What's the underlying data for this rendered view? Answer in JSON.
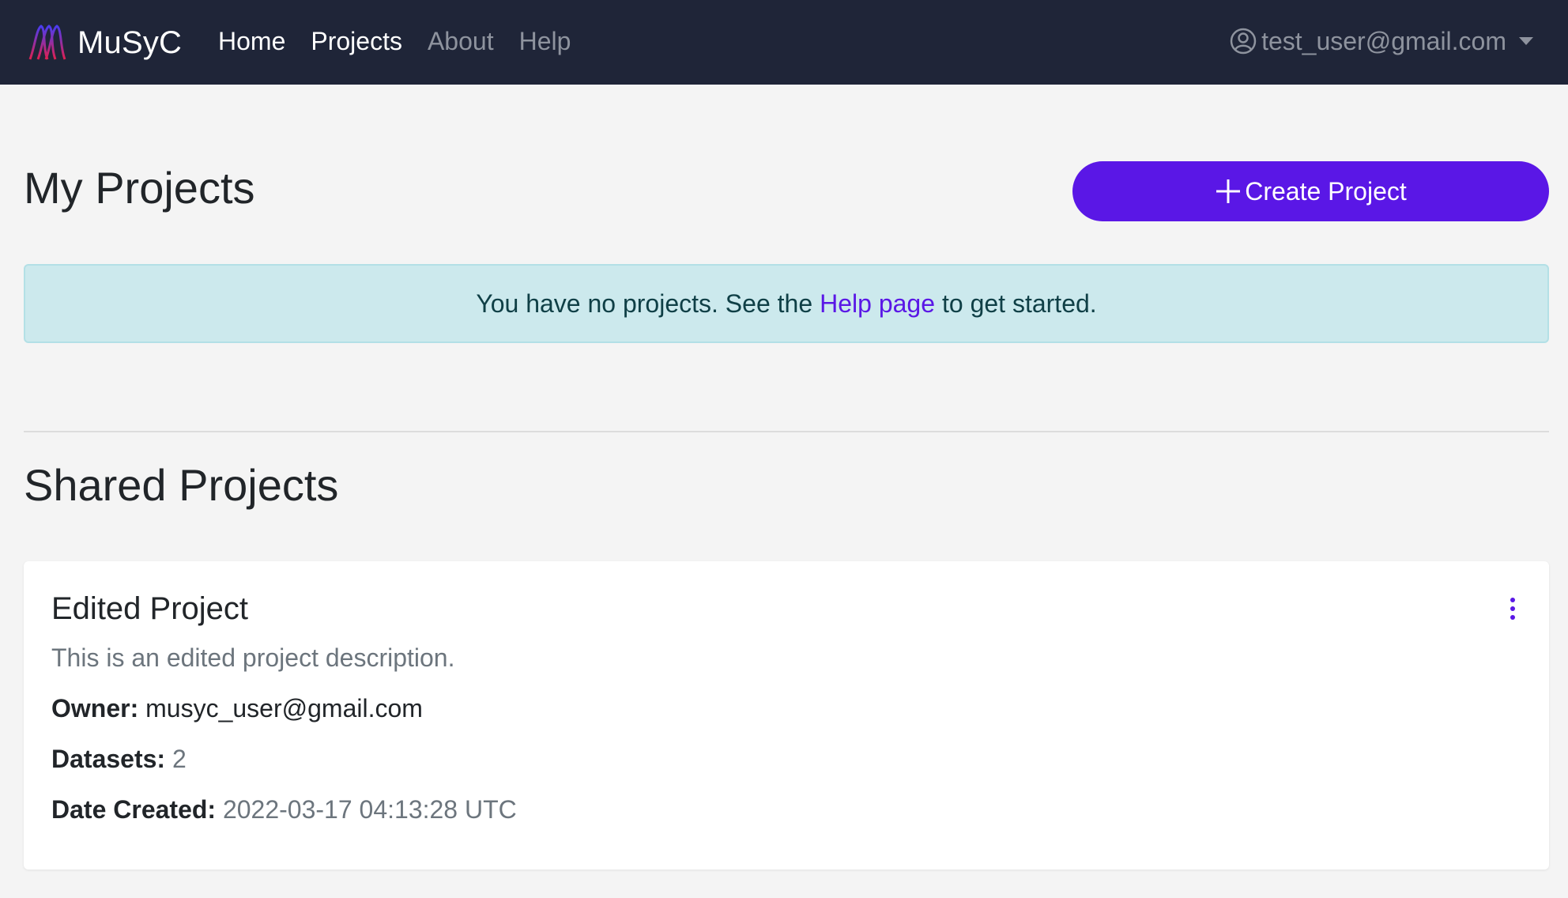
{
  "navbar": {
    "brand": "MuSyC",
    "links": [
      {
        "label": "Home",
        "active": true
      },
      {
        "label": "Projects",
        "active": true
      },
      {
        "label": "About",
        "active": false
      },
      {
        "label": "Help",
        "active": false
      }
    ],
    "user_email": "test_user@gmail.com",
    "user_icon": "user-circle-icon"
  },
  "my_projects": {
    "title": "My Projects",
    "create_button": "Create Project",
    "empty_alert": {
      "prefix": "You have no projects. See the",
      "link": "Help page",
      "suffix": "to get started."
    }
  },
  "shared_projects": {
    "title": "Shared Projects",
    "projects": [
      {
        "name": "Edited Project",
        "description": "This is an edited project description.",
        "owner_label": "Owner:",
        "owner": "musyc_user@gmail.com",
        "datasets_label": "Datasets:",
        "datasets": "2",
        "date_label": "Date Created:",
        "date_created": "2022-03-17 04:13:28 UTC"
      }
    ]
  },
  "colors": {
    "navbar_bg": "#1f2538",
    "accent": "#5a17e6",
    "alert_bg": "#cce9ed",
    "page_bg": "#f4f4f4"
  }
}
